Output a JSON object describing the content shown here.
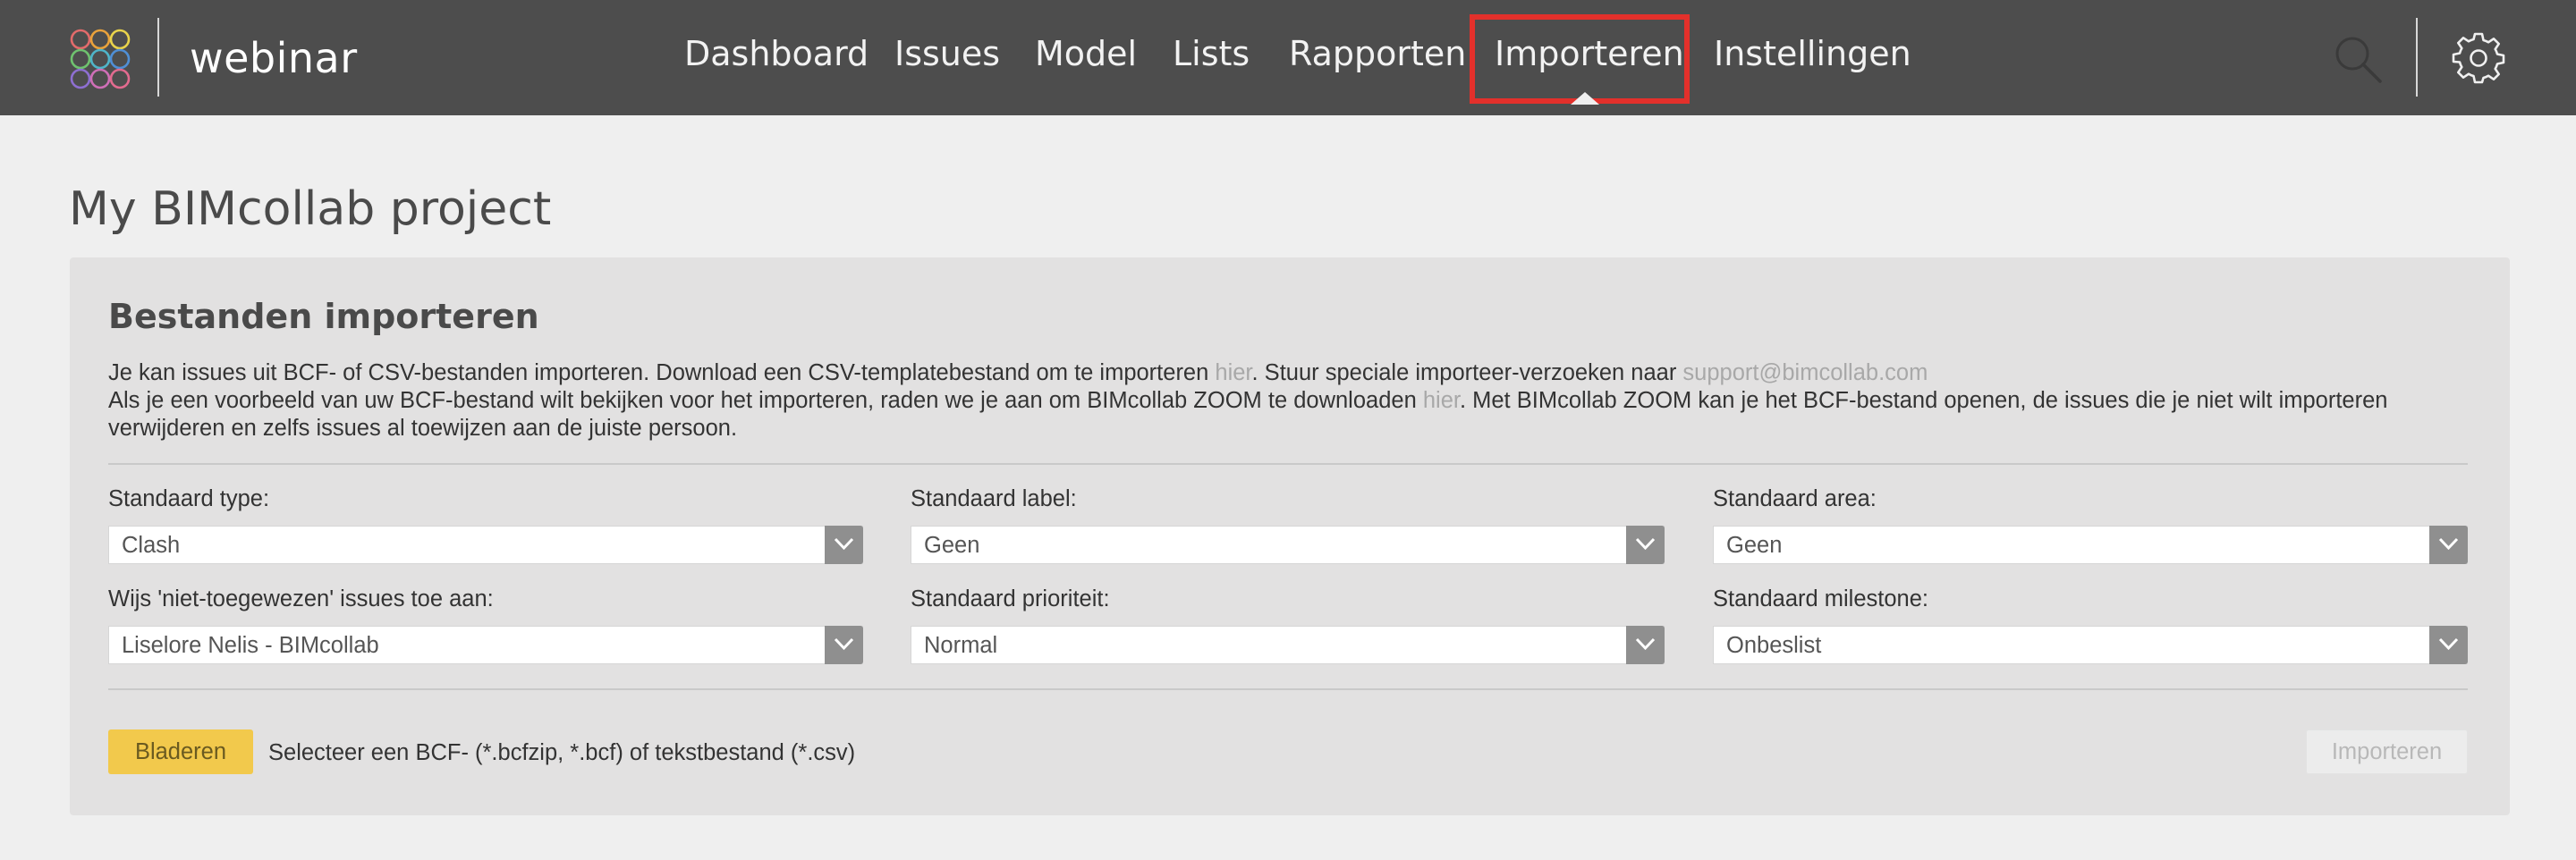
{
  "app": {
    "brand": "webinar",
    "logo_icon": "bimcollab-rings-logo-icon"
  },
  "nav": {
    "items": [
      {
        "label": "Dashboard"
      },
      {
        "label": "Issues"
      },
      {
        "label": "Model"
      },
      {
        "label": "Lists"
      },
      {
        "label": "Rapporten"
      },
      {
        "label": "Importeren",
        "active": true
      },
      {
        "label": "Instellingen"
      }
    ],
    "search_icon": "search-icon",
    "settings_icon": "gear-icon",
    "highlight_color": "#e3302b"
  },
  "page": {
    "title": "My BIMcollab project"
  },
  "import_panel": {
    "title": "Bestanden importeren",
    "intro": {
      "line1_a": "Je kan issues uit BCF- of CSV-bestanden importeren. Download een CSV-templatebestand om te importeren ",
      "line1_link": "hier",
      "line1_b": ". Stuur speciale importeer-verzoeken naar ",
      "line1_email": "support@bimcollab.com",
      "line2_a": "Als je een voorbeeld van uw BCF-bestand wilt bekijken voor het importeren, raden we je aan om BIMcollab ZOOM te downloaden ",
      "line2_link": "hier",
      "line2_b": ". Met BIMcollab ZOOM kan je het BCF-bestand openen, de issues die je niet wilt importeren verwijderen en zelfs issues al toewijzen aan de juiste persoon."
    },
    "fields": {
      "type": {
        "label": "Standaard type:",
        "value": "Clash"
      },
      "label": {
        "label": "Standaard label:",
        "value": "Geen"
      },
      "area": {
        "label": "Standaard area:",
        "value": "Geen"
      },
      "assign": {
        "label": "Wijs 'niet-toegewezen' issues toe aan:",
        "value": "Liselore Nelis - BIMcollab"
      },
      "priority": {
        "label": "Standaard prioriteit:",
        "value": "Normal"
      },
      "milestone": {
        "label": "Standaard milestone:",
        "value": "Onbeslist"
      }
    },
    "browse_button": "Bladeren",
    "file_hint": "Selecteer een BCF- (*.bcfzip, *.bcf) of tekstbestand (*.csv)",
    "import_button": "Importeren",
    "browse_color": "#f2c94c"
  }
}
